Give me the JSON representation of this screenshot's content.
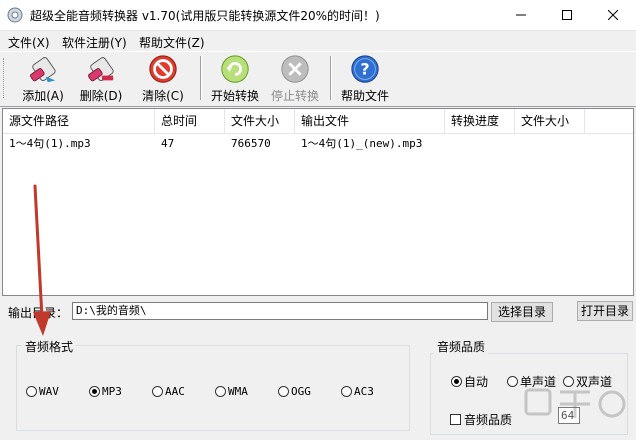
{
  "window": {
    "title": "超级全能音频转换器 v1.70(试用版只能转换源文件20%的时间！)"
  },
  "menu": [
    "文件(X)",
    "软件注册(Y)",
    "帮助文件(Z)"
  ],
  "toolbar": {
    "add": "添加(A)",
    "delete": "删除(D)",
    "clear": "清除(C)",
    "start": "开始转换",
    "stop": "停止转换",
    "help": "帮助文件"
  },
  "table": {
    "columns": [
      "源文件路径",
      "总时间",
      "文件大小",
      "输出文件",
      "转换进度",
      "文件大小"
    ],
    "rows": [
      [
        "1～4句(1).mp3",
        "47",
        "766570",
        "1～4句(1)_(new).mp3",
        "",
        ""
      ]
    ]
  },
  "output": {
    "label": "输出目录：",
    "path": "D:\\我的音频\\",
    "choose_button": "选择目录",
    "open_button": "打开目录"
  },
  "format": {
    "title": "音频格式",
    "options": [
      "WAV",
      "MP3",
      "AAC",
      "WMA",
      "OGG",
      "AC3"
    ],
    "selected": "MP3"
  },
  "quality": {
    "title": "音频品质",
    "options": [
      "自动",
      "单声道",
      "双声道"
    ],
    "selected": "自动",
    "checkbox_label": "音频品质",
    "checked": false,
    "bitrate": "64"
  },
  "colors": {
    "annotation_arrow": "#c0392b"
  }
}
